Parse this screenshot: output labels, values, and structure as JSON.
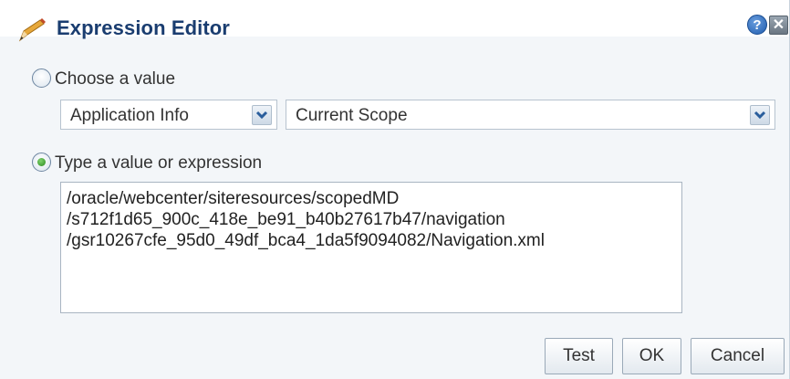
{
  "dialog": {
    "title": "Expression Editor",
    "help_icon": "?",
    "close_icon": "✕"
  },
  "choose_value": {
    "label": "Choose a value",
    "selected": false,
    "category_select": "Application Info",
    "scope_select": "Current Scope"
  },
  "type_value": {
    "label": "Type a value or expression",
    "selected": true,
    "lines": [
      "/oracle/webcenter/siteresources/scopedMD",
      "/s712f1d65_900c_418e_be91_b40b27617b47/navigation",
      "/gsr10267cfe_95d0_49df_bca4_1da5f9094082/Navigation.xml"
    ]
  },
  "buttons": {
    "test": "Test",
    "ok": "OK",
    "cancel": "Cancel"
  },
  "colors": {
    "title": "#1a3d70",
    "radio_selected": "#2b8a1f"
  },
  "icons": {
    "title": "pencil-icon",
    "help": "help-icon",
    "close": "close-icon",
    "dropdown": "chevron-down-icon"
  }
}
